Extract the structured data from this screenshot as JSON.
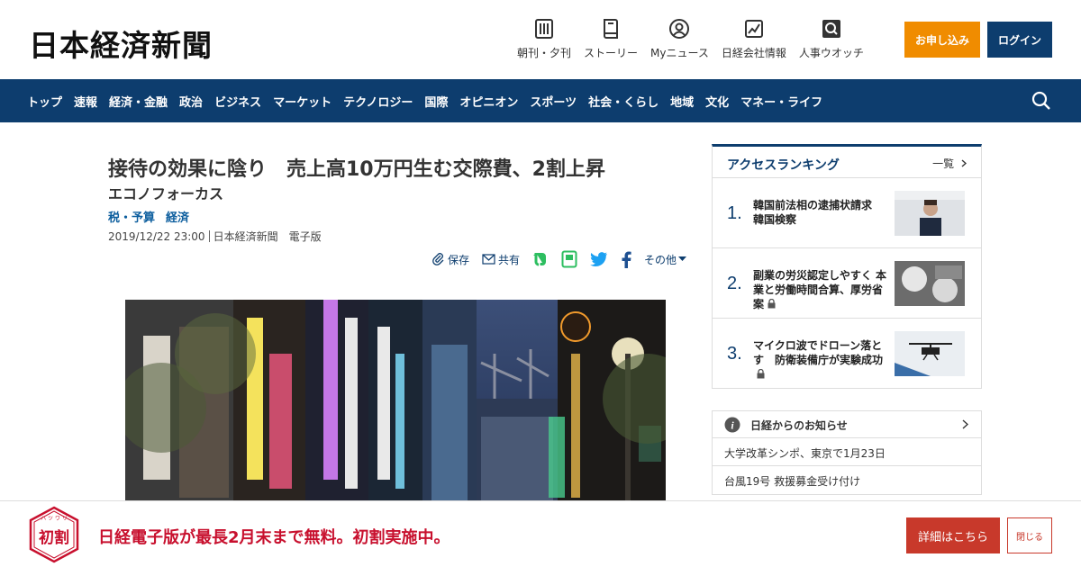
{
  "header": {
    "logo": "日本経済新聞",
    "nav": [
      {
        "label": "朝刊・夕刊",
        "icon": "newspaper-icon"
      },
      {
        "label": "ストーリー",
        "icon": "book-icon"
      },
      {
        "label": "Myニュース",
        "icon": "user-icon"
      },
      {
        "label": "日経会社情報",
        "icon": "chart-icon"
      },
      {
        "label": "人事ウオッチ",
        "icon": "search-person-icon"
      }
    ],
    "apply_label": "お申し込み",
    "login_label": "ログイン"
  },
  "navbar": {
    "items": [
      "トップ",
      "速報",
      "経済・金融",
      "政治",
      "ビジネス",
      "マーケット",
      "テクノロジー",
      "国際",
      "オピニオン",
      "スポーツ",
      "社会・くらし",
      "地域",
      "文化",
      "マネー・ライフ"
    ]
  },
  "article": {
    "headline": "接待の効果に陰り　売上高10万円生む交際費、2割上昇",
    "subhead": "エコノフォーカス",
    "tags": [
      "税・予算",
      "経済"
    ],
    "date": "2019/12/22 23:00",
    "source": "日本経済新聞　電子版",
    "share": {
      "save": "保存",
      "share": "共有",
      "more": "その他"
    }
  },
  "ranking": {
    "title": "アクセスランキング",
    "all_label": "一覧",
    "items": [
      {
        "rank": "1.",
        "text": "韓国前法相の逮捕状請求　韓国検察",
        "locked": false
      },
      {
        "rank": "2.",
        "text": "副業の労災認定しやすく 本業と労働時間合算、厚労省案",
        "locked": true
      },
      {
        "rank": "3.",
        "text": "マイクロ波でドローン落とす　防衛装備庁が実験成功",
        "locked": true
      }
    ]
  },
  "notices": {
    "title": "日経からのお知らせ",
    "items": [
      "大学改革シンポ、東京で1月23日",
      "台風19号 救援募金受け付け"
    ]
  },
  "banner": {
    "badge_label": "初割",
    "badge_ruby": "ハ ツ ワ リ",
    "text": "日経電子版が最長2月末まで無料。初割実施中。",
    "details_label": "詳細はこちら",
    "close_label": "閉じる"
  },
  "colors": {
    "navy": "#0d3d6e",
    "orange": "#f08c00",
    "red": "#c8102e"
  }
}
